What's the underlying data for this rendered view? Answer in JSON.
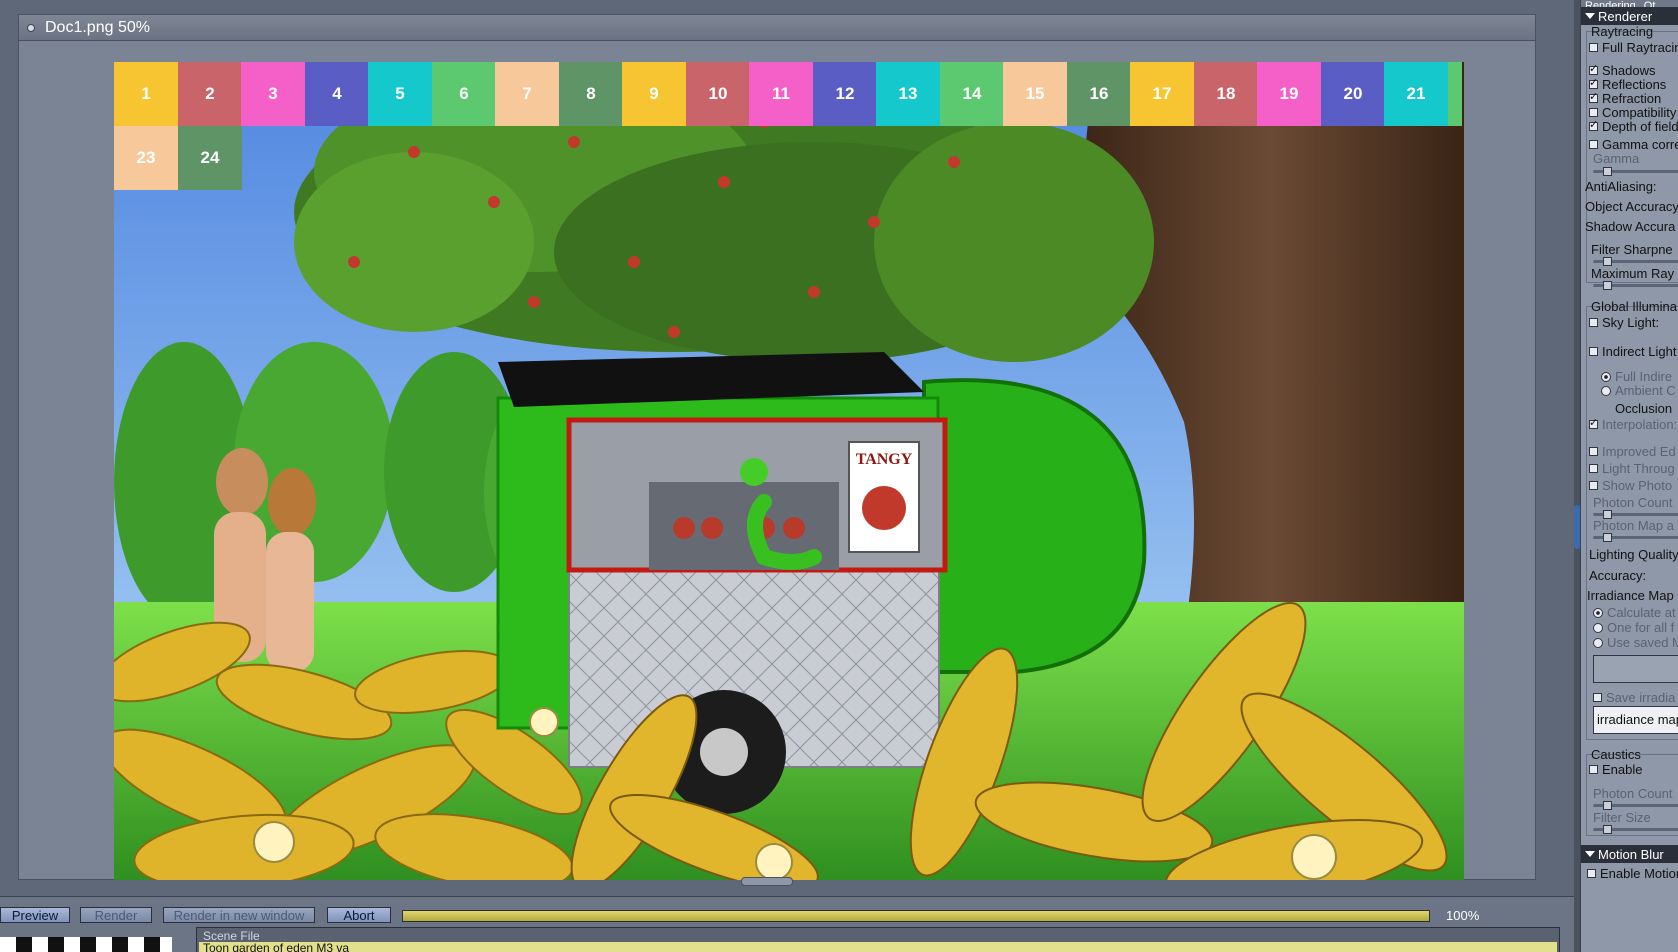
{
  "document": {
    "title": "Doc1.png 50%"
  },
  "grid": {
    "cells": [
      {
        "label": "1",
        "color": "#f7c531"
      },
      {
        "label": "2",
        "color": "#c9646a"
      },
      {
        "label": "3",
        "color": "#f560c8"
      },
      {
        "label": "4",
        "color": "#5a5ec4"
      },
      {
        "label": "5",
        "color": "#14c8cc"
      },
      {
        "label": "6",
        "color": "#5cc870"
      },
      {
        "label": "7",
        "color": "#f7c89a"
      },
      {
        "label": "8",
        "color": "#5f9466"
      },
      {
        "label": "9",
        "color": "#f7c531"
      },
      {
        "label": "10",
        "color": "#c9646a"
      },
      {
        "label": "11",
        "color": "#f560c8"
      },
      {
        "label": "12",
        "color": "#5a5ec4"
      },
      {
        "label": "13",
        "color": "#14c8cc"
      },
      {
        "label": "14",
        "color": "#5cc870"
      },
      {
        "label": "15",
        "color": "#f7c89a"
      },
      {
        "label": "16",
        "color": "#5f9466"
      },
      {
        "label": "17",
        "color": "#f7c531"
      },
      {
        "label": "18",
        "color": "#c9646a"
      },
      {
        "label": "19",
        "color": "#f560c8"
      },
      {
        "label": "20",
        "color": "#5a5ec4"
      },
      {
        "label": "21",
        "color": "#14c8cc"
      },
      {
        "label": "",
        "color": "#5cc870"
      },
      {
        "label": "23",
        "color": "#f7c89a"
      },
      {
        "label": "24",
        "color": "#5f9466"
      }
    ]
  },
  "scene": {
    "sign_text": "TANGY"
  },
  "right_panel": {
    "tabs": [
      "Rendering",
      "Ot"
    ],
    "renderer_header": "Renderer",
    "raytracing_title": "Raytracing",
    "full_raytracing": "Full Raytracin",
    "shadows": "Shadows",
    "reflections": "Reflections",
    "refraction": "Refraction",
    "compatibility": "Compatibility",
    "depth_of_field": "Depth of field",
    "gamma_correction": "Gamma corre",
    "gamma": "Gamma",
    "antialiasing": "AntiAliasing:",
    "object_accuracy": "Object Accuracy",
    "shadow_accuracy": "Shadow Accura",
    "filter_sharpness": "Filter Sharpne",
    "maximum_ray": "Maximum Ray",
    "global_illumination": "Global Illumina",
    "sky_light": "Sky Light:",
    "indirect_light": "Indirect Light",
    "full_indirect": "Full Indire",
    "ambient": "Ambient C",
    "occlusion": "Occlusion",
    "interpolation": "Interpolation:",
    "improved_edges": "Improved Ed",
    "light_through": "Light Throug",
    "show_photons": "Show Photo",
    "photon_count": "Photon Count",
    "photon_map": "Photon Map a",
    "lighting_quality": "Lighting Quality",
    "accuracy": "Accuracy:",
    "irradiance_map": "Irradiance Map",
    "calculate_at": "Calculate at",
    "one_for_all": "One for all f",
    "use_saved": "Use saved M",
    "save_irradiance": "Save irradia",
    "irradiance_field": "irradiance map",
    "caustics_title": "Caustics",
    "caustics_enable": "Enable",
    "caustics_photon_count": "Photon Count",
    "caustics_filter_size": "Filter Size",
    "motion_blur_header": "Motion Blur",
    "enable_motion": "Enable Motion"
  },
  "bottom_bar": {
    "preview_label": "Preview",
    "render_label": "Render",
    "render_new_window_label": "Render in new window",
    "abort_label": "Abort",
    "progress": 1.0,
    "progress_text": "100%",
    "scene_file_label": "Scene File",
    "scene_file_value": "Toon garden of eden M3 va"
  }
}
